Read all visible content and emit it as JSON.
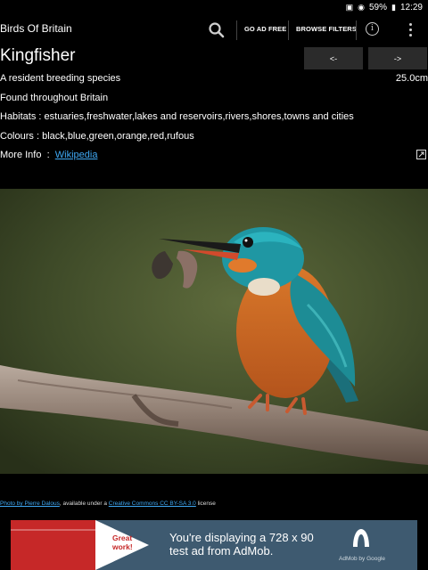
{
  "status_bar": {
    "battery_level": "59%",
    "time": "12:29"
  },
  "app_bar": {
    "title": "Birds Of Britain",
    "go_ad_free": "GO AD FREE",
    "browse_filters": "BROWSE FILTERS",
    "info_glyph": "i"
  },
  "species": {
    "name": "Kingfisher",
    "prev_label": "<-",
    "next_label": "->",
    "status": "A resident breeding species",
    "size": "25.0cm",
    "range": "Found throughout Britain",
    "habitats_label": "Habitats : ",
    "habitats": "estuaries,freshwater,lakes and reservoirs,rivers,shores,towns and cities",
    "colours_label": "Colours : ",
    "colours": "black,blue,green,orange,red,rufous",
    "more_info_label": "More Info  :  ",
    "wiki_link": "Wikipedia"
  },
  "credit": {
    "photo_link": "Photo by Pierre Dalous",
    "middle": ", available under a ",
    "license_link": "Creative Commons CC BY-SA 3.0",
    "suffix": " license"
  },
  "ad": {
    "badge_line1": "Great",
    "badge_line2": "work!",
    "line1": "You're displaying a 728 x 90",
    "line2": "test ad from AdMob.",
    "brand": "AdMob by Google"
  },
  "colors": {
    "link": "#3fa9f5",
    "nav_button": "#2b2b2b",
    "ad_background": "#3e5a70",
    "ad_accent": "#c62828"
  }
}
